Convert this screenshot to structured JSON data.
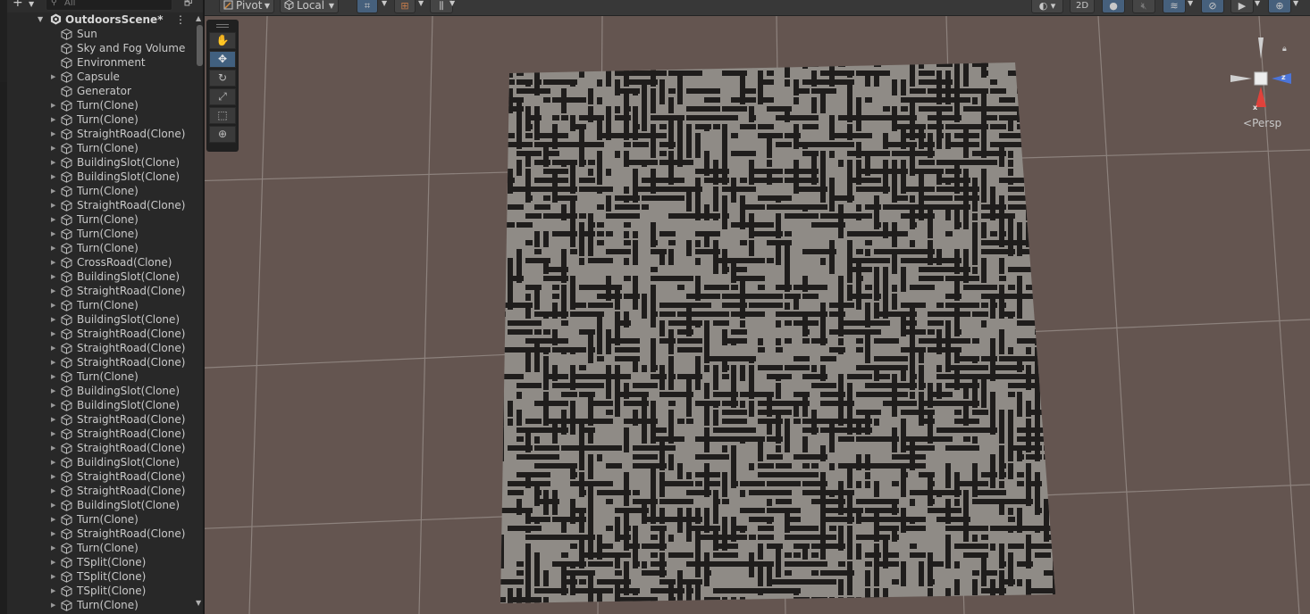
{
  "hierarchy": {
    "create_label": "+",
    "search_placeholder": "All",
    "scene_name": "OutdoorsScene*",
    "items": [
      {
        "label": "Sun",
        "expandable": false
      },
      {
        "label": "Sky and Fog Volume",
        "expandable": false
      },
      {
        "label": "Environment",
        "expandable": false
      },
      {
        "label": "Capsule",
        "expandable": true
      },
      {
        "label": "Generator",
        "expandable": false
      },
      {
        "label": "Turn(Clone)",
        "expandable": true
      },
      {
        "label": "Turn(Clone)",
        "expandable": true
      },
      {
        "label": "StraightRoad(Clone)",
        "expandable": true
      },
      {
        "label": "Turn(Clone)",
        "expandable": true
      },
      {
        "label": "BuildingSlot(Clone)",
        "expandable": true
      },
      {
        "label": "BuildingSlot(Clone)",
        "expandable": true
      },
      {
        "label": "Turn(Clone)",
        "expandable": true
      },
      {
        "label": "StraightRoad(Clone)",
        "expandable": true
      },
      {
        "label": "Turn(Clone)",
        "expandable": true
      },
      {
        "label": "Turn(Clone)",
        "expandable": true
      },
      {
        "label": "Turn(Clone)",
        "expandable": true
      },
      {
        "label": "CrossRoad(Clone)",
        "expandable": true
      },
      {
        "label": "BuildingSlot(Clone)",
        "expandable": true
      },
      {
        "label": "StraightRoad(Clone)",
        "expandable": true
      },
      {
        "label": "Turn(Clone)",
        "expandable": true
      },
      {
        "label": "BuildingSlot(Clone)",
        "expandable": true
      },
      {
        "label": "StraightRoad(Clone)",
        "expandable": true
      },
      {
        "label": "StraightRoad(Clone)",
        "expandable": true
      },
      {
        "label": "StraightRoad(Clone)",
        "expandable": true
      },
      {
        "label": "Turn(Clone)",
        "expandable": true
      },
      {
        "label": "BuildingSlot(Clone)",
        "expandable": true
      },
      {
        "label": "BuildingSlot(Clone)",
        "expandable": true
      },
      {
        "label": "StraightRoad(Clone)",
        "expandable": true
      },
      {
        "label": "StraightRoad(Clone)",
        "expandable": true
      },
      {
        "label": "StraightRoad(Clone)",
        "expandable": true
      },
      {
        "label": "BuildingSlot(Clone)",
        "expandable": true
      },
      {
        "label": "StraightRoad(Clone)",
        "expandable": true
      },
      {
        "label": "StraightRoad(Clone)",
        "expandable": true
      },
      {
        "label": "BuildingSlot(Clone)",
        "expandable": true
      },
      {
        "label": "Turn(Clone)",
        "expandable": true
      },
      {
        "label": "StraightRoad(Clone)",
        "expandable": true
      },
      {
        "label": "Turn(Clone)",
        "expandable": true
      },
      {
        "label": "TSplit(Clone)",
        "expandable": true
      },
      {
        "label": "TSplit(Clone)",
        "expandable": true
      },
      {
        "label": "TSplit(Clone)",
        "expandable": true
      },
      {
        "label": "Turn(Clone)",
        "expandable": true
      }
    ]
  },
  "scene_toolbar": {
    "pivot_label": "Pivot",
    "space_label": "Local",
    "mode_2d_label": "2D"
  },
  "scene_view": {
    "persp_label": "Persp",
    "axis_x_label": "x",
    "axis_z_label": "z",
    "colors": {
      "background": "#645550",
      "plane": "#8f8b86",
      "road": "#1f1d1c",
      "grid": "#8d827d",
      "gizmo_x": "#e0423b",
      "gizmo_z": "#4b74d8",
      "active_tool": "#41607f"
    },
    "tools": [
      {
        "name": "hand-tool",
        "icon": "✋",
        "active": false
      },
      {
        "name": "move-tool",
        "icon": "✥",
        "active": true
      },
      {
        "name": "rotate-tool",
        "icon": "↻",
        "active": false
      },
      {
        "name": "scale-tool",
        "icon": "⤢",
        "active": false
      },
      {
        "name": "rect-tool",
        "icon": "⬚",
        "active": false
      },
      {
        "name": "transform-tool",
        "icon": "⊕",
        "active": false
      }
    ]
  }
}
